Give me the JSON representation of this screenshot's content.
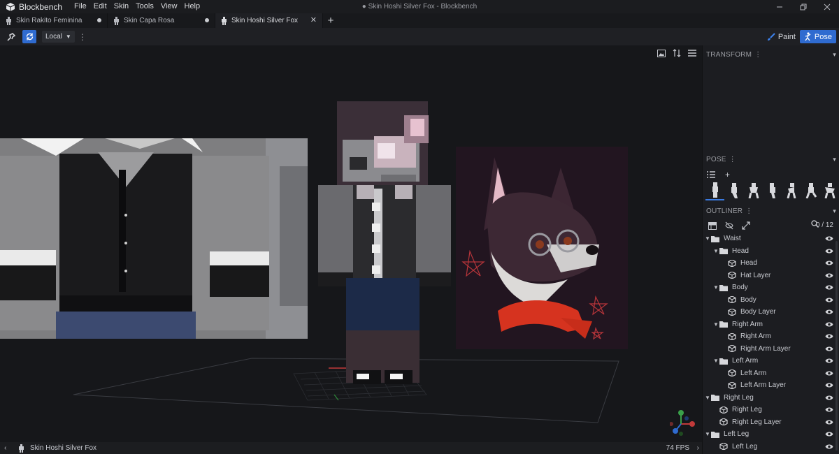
{
  "app": {
    "name": "Blockbench",
    "window_title": "● Skin Hoshi Silver Fox - Blockbench",
    "menu": [
      "File",
      "Edit",
      "Skin",
      "Tools",
      "View",
      "Help"
    ]
  },
  "tabs": [
    {
      "label": "Skin Rakito Feminina",
      "modified": true
    },
    {
      "label": "Skin Capa Rosa",
      "modified": true
    },
    {
      "label": "Skin Hoshi Silver Fox",
      "modified": false,
      "active": true
    }
  ],
  "toolbar": {
    "space_select": "Local",
    "modes": [
      "Paint",
      "Pose"
    ],
    "active_mode": "Pose"
  },
  "panels": {
    "transform": "TRANSFORM",
    "pose": "POSE",
    "outliner": "OUTLINER"
  },
  "outliner": {
    "count": "0 / 12",
    "tree": [
      {
        "label": "Waist",
        "type": "group",
        "depth": 0
      },
      {
        "label": "Head",
        "type": "group",
        "depth": 1
      },
      {
        "label": "Head",
        "type": "cube",
        "depth": 2
      },
      {
        "label": "Hat Layer",
        "type": "cube",
        "depth": 2
      },
      {
        "label": "Body",
        "type": "group",
        "depth": 1
      },
      {
        "label": "Body",
        "type": "cube",
        "depth": 2
      },
      {
        "label": "Body Layer",
        "type": "cube",
        "depth": 2
      },
      {
        "label": "Right Arm",
        "type": "group",
        "depth": 1
      },
      {
        "label": "Right Arm",
        "type": "cube",
        "depth": 2
      },
      {
        "label": "Right Arm Layer",
        "type": "cube",
        "depth": 2
      },
      {
        "label": "Left Arm",
        "type": "group",
        "depth": 1
      },
      {
        "label": "Left Arm",
        "type": "cube",
        "depth": 2
      },
      {
        "label": "Left Arm Layer",
        "type": "cube",
        "depth": 2
      },
      {
        "label": "Right Leg",
        "type": "group",
        "depth": 0
      },
      {
        "label": "Right Leg",
        "type": "cube",
        "depth": 1
      },
      {
        "label": "Right Leg Layer",
        "type": "cube",
        "depth": 1
      },
      {
        "label": "Left Leg",
        "type": "group",
        "depth": 0
      },
      {
        "label": "Left Leg",
        "type": "cube",
        "depth": 1
      }
    ]
  },
  "status": {
    "project_name": "Skin Hoshi Silver Fox",
    "fps": "74 FPS"
  },
  "colors": {
    "accent": "#2f6bd0",
    "background": "#16171a",
    "panel": "#1c1d21"
  }
}
